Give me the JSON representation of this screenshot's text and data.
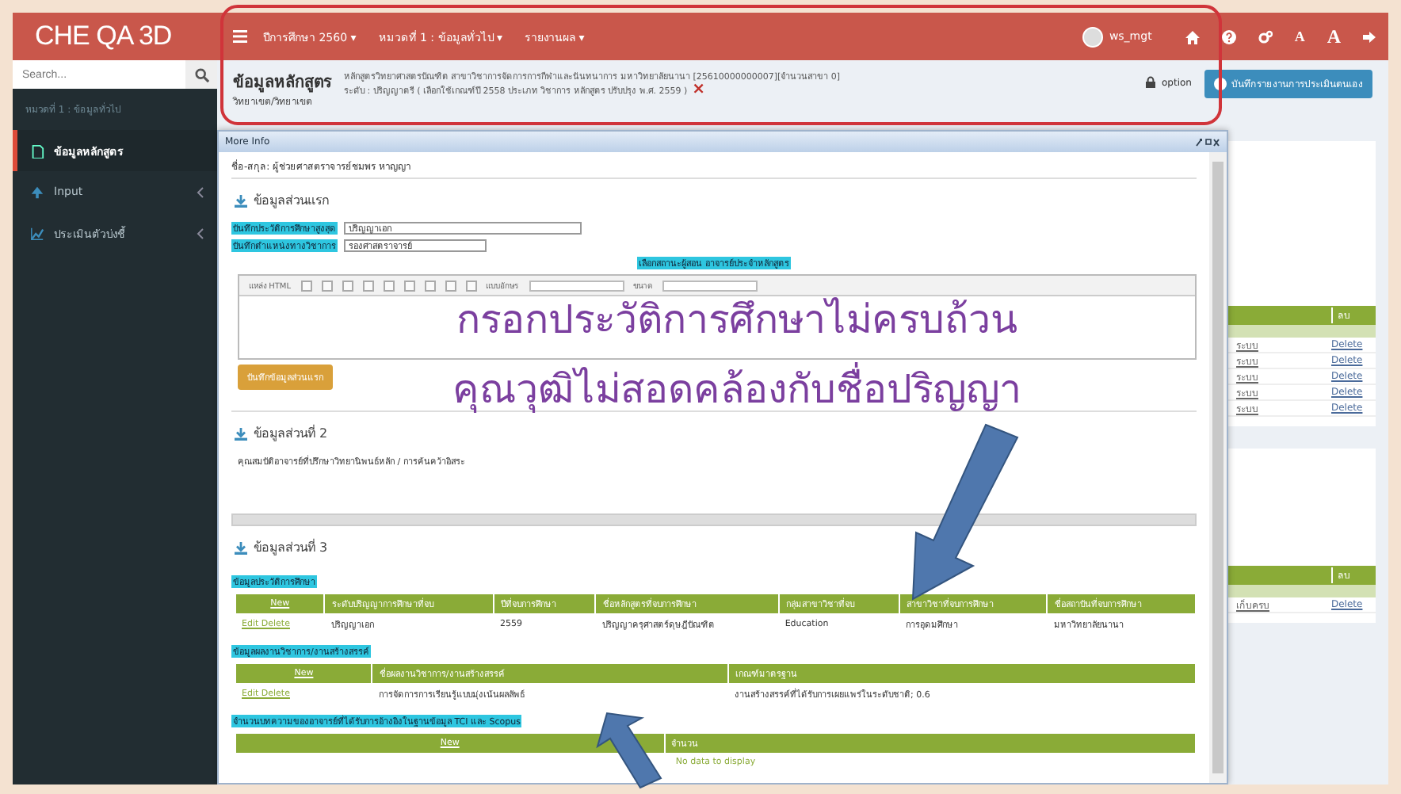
{
  "topbar": {
    "logo": "CHE QA 3D",
    "menus": [
      {
        "label": "ปีการศึกษา 2560 ▾"
      },
      {
        "label": "หมวดที่ 1 : ข้อมูลทั่วไป ▾"
      },
      {
        "label": "รายงานผล ▾"
      }
    ],
    "user": "ws_mgt",
    "font_buttons": [
      "A",
      "A"
    ]
  },
  "sidebar": {
    "search": {
      "placeholder": "Search..."
    },
    "breadcrumb": "หมวดที่ 1 : ข้อมูลทั่วไป",
    "items": [
      {
        "label": "ข้อมูลหลักสูตร",
        "kind": "file",
        "selected": true,
        "expandable": false
      },
      {
        "label": "Input",
        "kind": "upload",
        "selected": false,
        "expandable": true
      },
      {
        "label": "ประเมินตัวบ่งชี้",
        "kind": "chart",
        "selected": false,
        "expandable": true
      }
    ]
  },
  "header": {
    "title": "ข้อมูลหลักสูตร",
    "lines": [
      "หลักสูตรวิทยาศาสตรบัณฑิต สาขาวิชาการจัดการการกีฬาและนันทนาการ มหาวิทยาลัยนานา [25610000000007][จำนวนสาขา 0]",
      "ระดับ : ปริญญาตรี ( เลือกใช้เกณฑ์ปี 2558 ประเภท วิชาการ หลักสูตร ปรับปรุง พ.ศ. 2559 )"
    ],
    "close": "×",
    "campus": "วิทยาเขต/วิทยาเขต",
    "option": "option",
    "save_button": "บันทึกรายงานการประเมินตนเอง"
  },
  "background_table": {
    "header": [
      "ลบ"
    ],
    "rows": [
      {
        "col1": "ระบบ",
        "action": "Delete"
      },
      {
        "col1": "ระบบ",
        "action": "Delete"
      },
      {
        "col1": "ระบบ",
        "action": "Delete"
      },
      {
        "col1": "ระบบ",
        "action": "Delete"
      },
      {
        "col1": "ระบบ",
        "action": "Delete"
      }
    ]
  },
  "background_table_2": {
    "header": [
      "ลบ"
    ],
    "rows": [
      {
        "col1": "เก็บครบ",
        "action": "Delete"
      }
    ]
  },
  "modal": {
    "title": "More Info",
    "person": "ชื่อ-สกุล: ผู้ช่วยศาสตราจารย์ชมพร หาญญา",
    "part1": {
      "title": "ข้อมูลส่วนแรก",
      "fields": [
        {
          "label": "บันทึกประวัติการศึกษาสูงสุด",
          "value": "ปริญญาเอก"
        },
        {
          "label": "บันทึกตำแหน่งทางวิชาการ",
          "value": "รองศาสตราจารย์"
        }
      ],
      "status_label": "เลือกสถานะผู้สอน อาจารย์ประจำหลักสูตร",
      "toolbar": {
        "source": "แหล่ง HTML",
        "font": "แบบอักษร",
        "size": "ขนาด"
      },
      "save": "บันทึกข้อมูลส่วนแรก"
    },
    "part2": {
      "title": "ข้อมูลส่วนที่ 2",
      "text": "คุณสมบัติอาจารย์ที่ปรึกษาวิทยานิพนธ์หลัก / การค้นคว้าอิสระ"
    },
    "part3": {
      "title": "ข้อมูลส่วนที่ 3",
      "tables": [
        {
          "caption": "ข้อมูลประวัติการศึกษา",
          "columns": [
            "New",
            "ระดับปริญญาการศึกษาที่จบ",
            "ปีที่จบการศึกษา",
            "ชื่อหลักสูตรที่จบการศึกษา",
            "กลุ่มสาขาวิชาที่จบ",
            "สาขาวิชาที่จบการศึกษา",
            "ชื่อสถาบันที่จบการศึกษา"
          ],
          "rows": [
            [
              "Edit Delete",
              "ปริญญาเอก",
              "2559",
              "ปริญญาครุศาสตร์ดุษฎีบัณฑิต",
              "Education",
              "การอุดมศึกษา",
              "มหาวิทยาลัยนานา"
            ]
          ]
        },
        {
          "caption": "ข้อมูลผลงานวิชาการ/งานสร้างสรรค์",
          "columns": [
            "New",
            "ชื่อผลงานวิชาการ/งานสร้างสรรค์",
            "เกณฑ์มาตรฐาน"
          ],
          "rows": [
            [
              "Edit Delete",
              "การจัดการการเรียนรู้แบบมุ่งเน้นผลลัพธ์",
              "งานสร้างสรรค์ที่ได้รับการเผยแพร่ในระดับชาติ; 0.6"
            ]
          ]
        },
        {
          "caption": "จำนวนบทความของอาจารย์ที่ได้รับการอ้างอิงในฐานข้อมูล TCI และ Scopus",
          "columns": [
            "New",
            "จำนวน"
          ],
          "empty": "No data to display"
        }
      ]
    }
  },
  "annotations": {
    "texts": [
      "กรอกประวัติการศึกษาไม่ครบถ้วน",
      "คุณวุฒิไม่สอดคล้องกับชื่อปริญญา"
    ]
  }
}
